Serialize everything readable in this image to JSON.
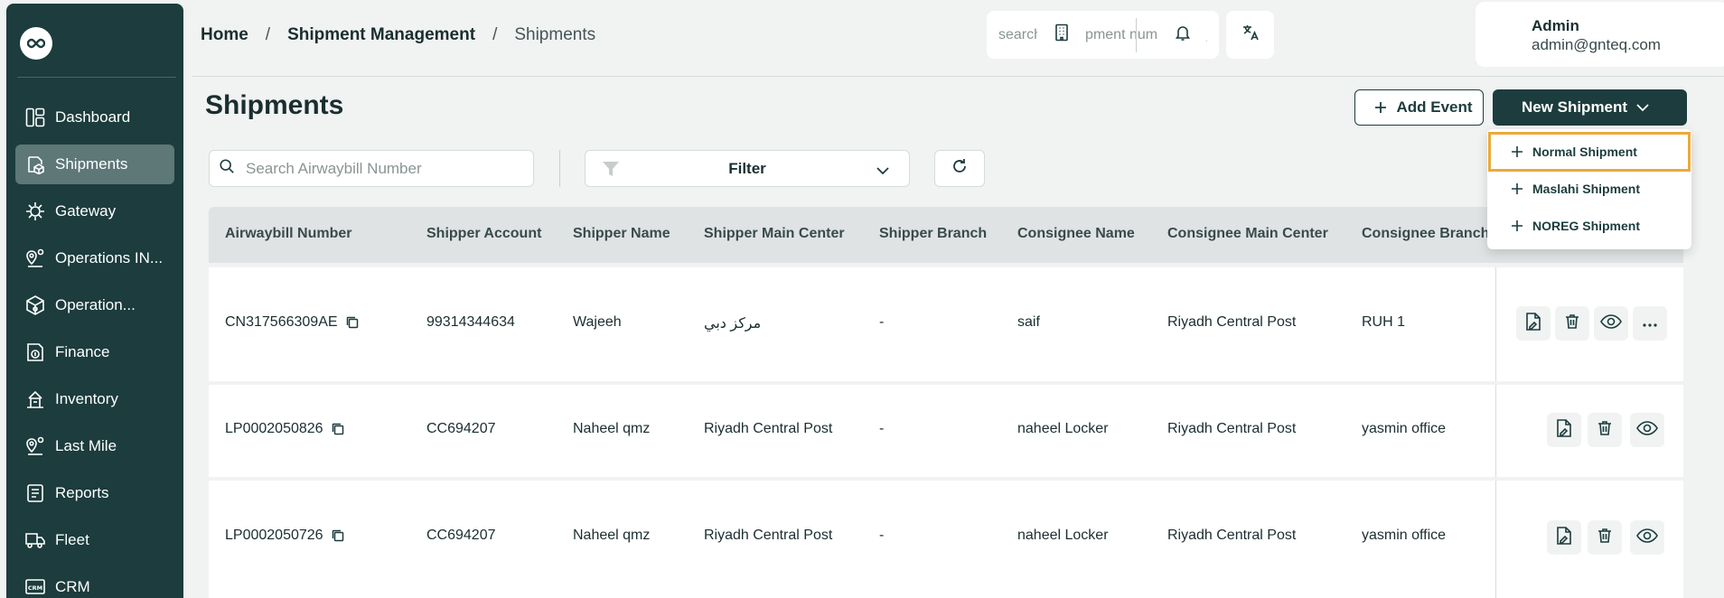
{
  "sidebar": {
    "items": [
      {
        "label": "Dashboard",
        "icon": "dashboard-icon"
      },
      {
        "label": "Shipments",
        "icon": "shipment-box-icon"
      },
      {
        "label": "Gateway",
        "icon": "gateway-icon"
      },
      {
        "label": "Operations IN...",
        "icon": "operations-pin-icon"
      },
      {
        "label": "Operation...",
        "icon": "operation-box-icon"
      },
      {
        "label": "Finance",
        "icon": "finance-icon"
      },
      {
        "label": "Inventory",
        "icon": "inventory-icon"
      },
      {
        "label": "Last Mile",
        "icon": "last-mile-icon"
      },
      {
        "label": "Reports",
        "icon": "reports-icon"
      },
      {
        "label": "Fleet",
        "icon": "fleet-truck-icon"
      },
      {
        "label": "CRM",
        "icon": "crm-icon"
      }
    ],
    "active": "Shipments"
  },
  "header": {
    "breadcrumb": [
      "Home",
      "Shipment Management",
      "Shipments"
    ],
    "search_placeholder": "search for shipment number",
    "user": {
      "name": "Admin",
      "email": "admin@gnteq.com"
    }
  },
  "main": {
    "title": "Shipments",
    "add_event_label": "Add Event",
    "new_shipment_label": "New Shipment",
    "search_placeholder": "Search Airwaybill Number",
    "filter_label": "Filter"
  },
  "dropdown": {
    "items": [
      "Normal Shipment",
      "Maslahi Shipment",
      "NOREG Shipment"
    ],
    "highlighted": "Normal Shipment"
  },
  "table": {
    "columns": [
      "Airwaybill Number",
      "Shipper Account",
      "Shipper Name",
      "Shipper Main Center",
      "Shipper Branch",
      "Consignee Name",
      "Consignee Main Center",
      "Consignee Branch"
    ],
    "rows": [
      [
        "CN317566309AE",
        "99314344634",
        "Wajeeh",
        "مركز دبي",
        "-",
        "saif",
        "Riyadh Central Post",
        "RUH 1"
      ],
      [
        "LP0002050826",
        "CC694207",
        "Naheel qmz",
        "Riyadh Central Post",
        "-",
        "naheel Locker",
        "Riyadh Central Post",
        "yasmin office"
      ],
      [
        "LP0002050726",
        "CC694207",
        "Naheel qmz",
        "Riyadh Central Post",
        "-",
        "naheel Locker",
        "Riyadh Central Post",
        "yasmin office"
      ]
    ]
  },
  "colors": {
    "primary": "#1c3c3d",
    "active_nav": "#5e7777",
    "highlight": "#eca93a"
  }
}
